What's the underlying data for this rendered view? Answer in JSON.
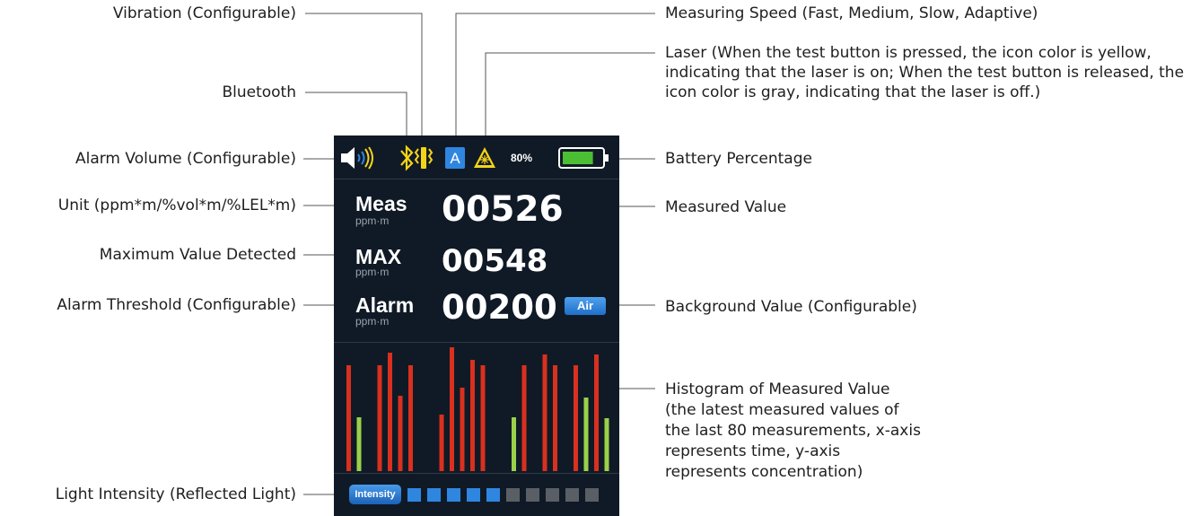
{
  "labels": {
    "vibration": "Vibration (Configurable)",
    "bluetooth": "Bluetooth",
    "alarm_volume": "Alarm Volume (Configurable)",
    "unit": "Unit (ppm*m/%vol*m/%LEL*m)",
    "max_value": "Maximum Value Detected",
    "alarm_threshold": "Alarm Threshold (Configurable)",
    "light_intensity": "Light Intensity (Reflected Light)",
    "measuring_speed": "Measuring Speed (Fast, Medium, Slow, Adaptive)",
    "laser": "Laser (When the test button is pressed, the icon color is yellow, indicating that the laser is on; When the test button is released, the icon color is gray, indicating that the laser is off.)",
    "battery": "Battery Percentage",
    "measured_value": "Measured Value",
    "background_value": "Background Value (Configurable)",
    "histogram": "Histogram of Measured Value (the latest measured values of the last 80 measurements, x-axis represents time, y-axis represents concentration)"
  },
  "device": {
    "speed_mode": "A",
    "battery_percent": "80%",
    "battery_fill_fraction": 0.8,
    "meas_label": "Meas",
    "meas_unit": "ppm·m",
    "meas_value": "00526",
    "max_label": "MAX",
    "max_unit": "ppm·m",
    "max_value": "00548",
    "alarm_label": "Alarm",
    "alarm_unit": "ppm·m",
    "alarm_value": "00200",
    "air_button": "Air",
    "intensity_button": "Intensity",
    "intensity_level": 5,
    "intensity_total": 10
  },
  "chart_data": {
    "type": "bar",
    "values": [
      118,
      60,
      0,
      118,
      132,
      84,
      118,
      0,
      0,
      63,
      138,
      93,
      124,
      118,
      0,
      0,
      60,
      118,
      0,
      130,
      118,
      0,
      118,
      82,
      130,
      59
    ],
    "colors": [
      "red",
      "green",
      "red",
      "red",
      "red",
      "red",
      "red",
      "red",
      "red",
      "red",
      "red",
      "red",
      "red",
      "red",
      "red",
      "red",
      "green",
      "red",
      "red",
      "red",
      "red",
      "red",
      "red",
      "green",
      "red",
      "green"
    ],
    "palette": {
      "red": "#d9301f",
      "green": "#9bd14a"
    }
  },
  "colors": {
    "screen_bg": "#101a26",
    "accent_blue": "#2f86e0",
    "icon_yellow": "#f5d418",
    "battery_green": "#4cbe34",
    "intensity_on": "#2f86e0",
    "intensity_off": "#5a5f66"
  },
  "icons": [
    "speaker-icon",
    "bluetooth-icon",
    "vibration-icon",
    "speed-mode-icon",
    "laser-warning-icon",
    "battery-icon"
  ]
}
